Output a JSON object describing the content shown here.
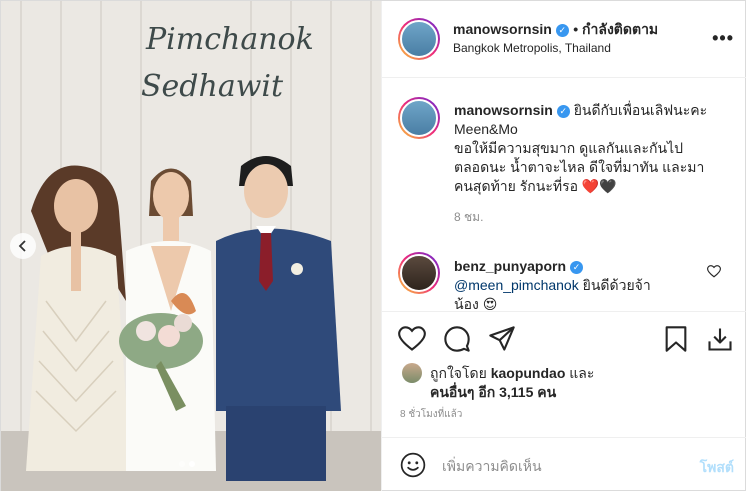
{
  "post": {
    "username": "manowsornsin",
    "follow_status": "• กำลังติดตาม",
    "location": "Bangkok Metropolis, Thailand",
    "more_label": "•••",
    "photo_sign_line1": "Pimchanok",
    "photo_sign_line2": "Sedhawit"
  },
  "caption": {
    "username": "manowsornsin",
    "line1": "ยินดีกับเพื่อนเลิฟนะคะ",
    "line2": "Meen&Mo",
    "line3": "ขอให้มีความสุขมาก ดูแลกันและกันไป",
    "line4": "ตลอดนะ น้ำตาจะไหล ดีใจที่มาทัน และมา",
    "line5": "คนสุดท้าย รักนะที่รอ ❤️🖤",
    "time": "8 ชม."
  },
  "comment1": {
    "username": "benz_punyaporn",
    "mention": "@meen_pimchanok",
    "text": "ยินดีด้วยจ้า",
    "text2": "น้อง 😍"
  },
  "likes": {
    "prefix": "ถูกใจโดย",
    "user": "kaopundao",
    "and": "และ",
    "others": "คนอื่นๆ อีก 3,115 คน"
  },
  "timestamp": "8 ชั่วโมงที่แล้ว",
  "comment_box": {
    "placeholder": "เพิ่มความคิดเห็น",
    "post_label": "โพสต์"
  },
  "colors": {
    "accent": "#3897f0",
    "post_disabled": "#b2dffc",
    "muted": "#8e8e8e"
  },
  "carousel": {
    "active_index": 1,
    "count": 2
  }
}
